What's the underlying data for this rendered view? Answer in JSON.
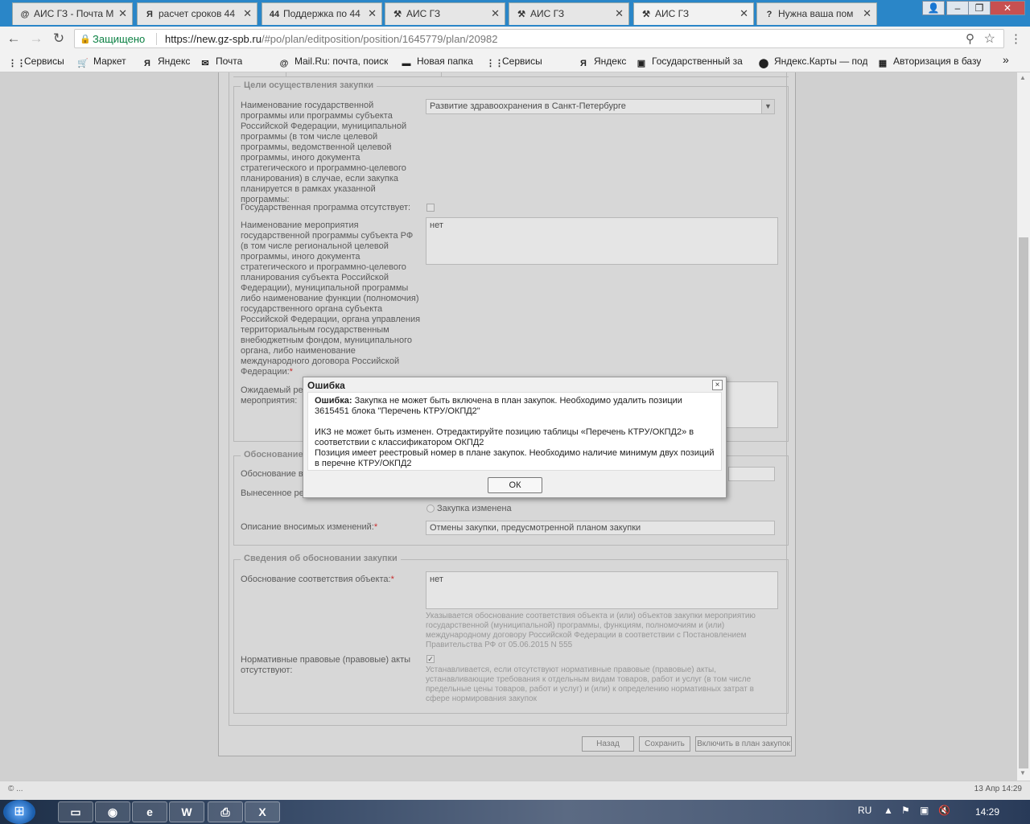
{
  "browser": {
    "tabs": [
      {
        "label": "АИС ГЗ - Почта М",
        "icon": "@",
        "icon_name": "mail-icon",
        "active": false
      },
      {
        "label": "расчет сроков 44",
        "icon": "Я",
        "icon_name": "yandex-icon",
        "active": false
      },
      {
        "label": "Поддержка по 44",
        "icon": "44",
        "icon_name": "support-icon",
        "active": false
      },
      {
        "label": "АИС ГЗ",
        "icon": "⚒",
        "icon_name": "ais-icon",
        "active": false
      },
      {
        "label": "АИС ГЗ",
        "icon": "⚒",
        "icon_name": "ais-icon",
        "active": false
      },
      {
        "label": "АИС ГЗ",
        "icon": "⚒",
        "icon_name": "ais-icon",
        "active": true
      },
      {
        "label": "Нужна ваша пом",
        "icon": "?",
        "icon_name": "help-icon",
        "active": false
      }
    ],
    "secure_label": "Защищено",
    "url_host": "https://new.gz-spb.ru",
    "url_path": "/#po/plan/editposition/position/1645779/plan/20982",
    "bookmarks": [
      {
        "label": "Сервисы",
        "icon": "⋮⋮",
        "icon_name": "apps-icon"
      },
      {
        "label": "Маркет",
        "icon": "🛒",
        "icon_name": "cart-icon"
      },
      {
        "label": "Яндекс",
        "icon": "Я",
        "icon_name": "yandex-icon"
      },
      {
        "label": "Почта",
        "icon": "✉",
        "icon_name": "mail-icon"
      },
      {
        "label": "Mail.Ru: почта, поиск",
        "icon": "@",
        "icon_name": "mailru-icon"
      },
      {
        "label": "Новая папка",
        "icon": "▬",
        "icon_name": "folder-icon"
      },
      {
        "label": "Сервисы",
        "icon": "⋮⋮",
        "icon_name": "apps-icon"
      },
      {
        "label": "Яндекс",
        "icon": "Я",
        "icon_name": "yandex-icon"
      },
      {
        "label": "Государственный за",
        "icon": "▣",
        "icon_name": "gov-icon"
      },
      {
        "label": "Яндекс.Карты — под",
        "icon": "⬤",
        "icon_name": "map-pin-icon"
      },
      {
        "label": "Авторизация в базу",
        "icon": "▦",
        "icon_name": "flag-icon"
      }
    ],
    "more_bookmarks": "»"
  },
  "form": {
    "section_goals": "Цели осуществления закупки",
    "program_label": "Наименование государственной программы или программы субъекта Российской Федерации, муниципальной программы (в том числе целевой программы, ведомственной целевой программы, иного документа стратегического и программно-целевого планирования) в случае, если закупка планируется в рамках указанной программы:",
    "program_value": "Развитие здравоохранения в Санкт-Петербурге",
    "no_program_label": "Государственная программа отсутствует:",
    "event_label": "Наименование мероприятия государственной программы субъекта РФ (в том числе региональной целевой программы, иного документа стратегического и программно-целевого планирования субъекта Российской Федерации), муниципальной программы либо наименование функции (полномочия) государственного органа субъекта Российской Федерации, органа управления территориальным государственным внебюджетным фондом, муниципального органа, либо наименование международного договора Российской Федерации:",
    "event_value": "нет",
    "expected_label_a": "Ожидаемый рез",
    "expected_label_b": "мероприятия:",
    "section_reason_a": "Обоснование в",
    "reason_label_a": "Обоснование вн",
    "decision_label_a": "Вынесенное ре",
    "radio_changed": "Закупка изменена",
    "changes_label": "Описание вносимых изменений:",
    "changes_value": "Отмены закупки, предусмотренной планом закупки",
    "section_justification": "Сведения об обосновании закупки",
    "conformity_label": "Обоснование соответствия объекта:",
    "conformity_value": "нет",
    "conformity_hint": "Указывается обоснование соответствия объекта и (или) объектов закупки мероприятию государственной (муниципальной) программы, функциям, полномочиям и (или) международному договору Российской Федерации в соответствии с Постановлением Правительства РФ от 05.06.2015 N 555",
    "legal_label": "Нормативные правовые (правовые) акты отсутствуют:",
    "legal_hint": "Устанавливается, если отсутствуют нормативные правовые (правовые) акты, устанавливающие требования к отдельным видам товаров, работ и услуг (в том числе предельные цены товаров, работ и услуг) и (или) к определению нормативных затрат в сфере нормирования закупок",
    "required_mark": "*",
    "btn_back": "Назад",
    "btn_save": "Сохранить",
    "btn_include": "Включить в план закупок"
  },
  "dialog": {
    "title": "Ошибка",
    "close": "×",
    "error_prefix": "Ошибка:",
    "line1": " Закупка не может быть включена в план закупок. Необходимо удалить позиции 3615451 блока \"Перечень КТРУ/ОКПД2\"",
    "line2": "ИКЗ не может быть изменен. Отредактируйте позицию таблицы «Перечень КТРУ/ОКПД2» в соответствии с классификатором ОКПД2",
    "line3": "Позиция имеет реестровый номер в плане закупок. Необходимо наличие минимум двух позиций в перечне КТРУ/ОКПД2",
    "ok": "ОК"
  },
  "status": {
    "left": "© ...",
    "right": "13 Апр 14:29"
  },
  "taskbar": {
    "lang": "RU",
    "time": "14:29"
  }
}
